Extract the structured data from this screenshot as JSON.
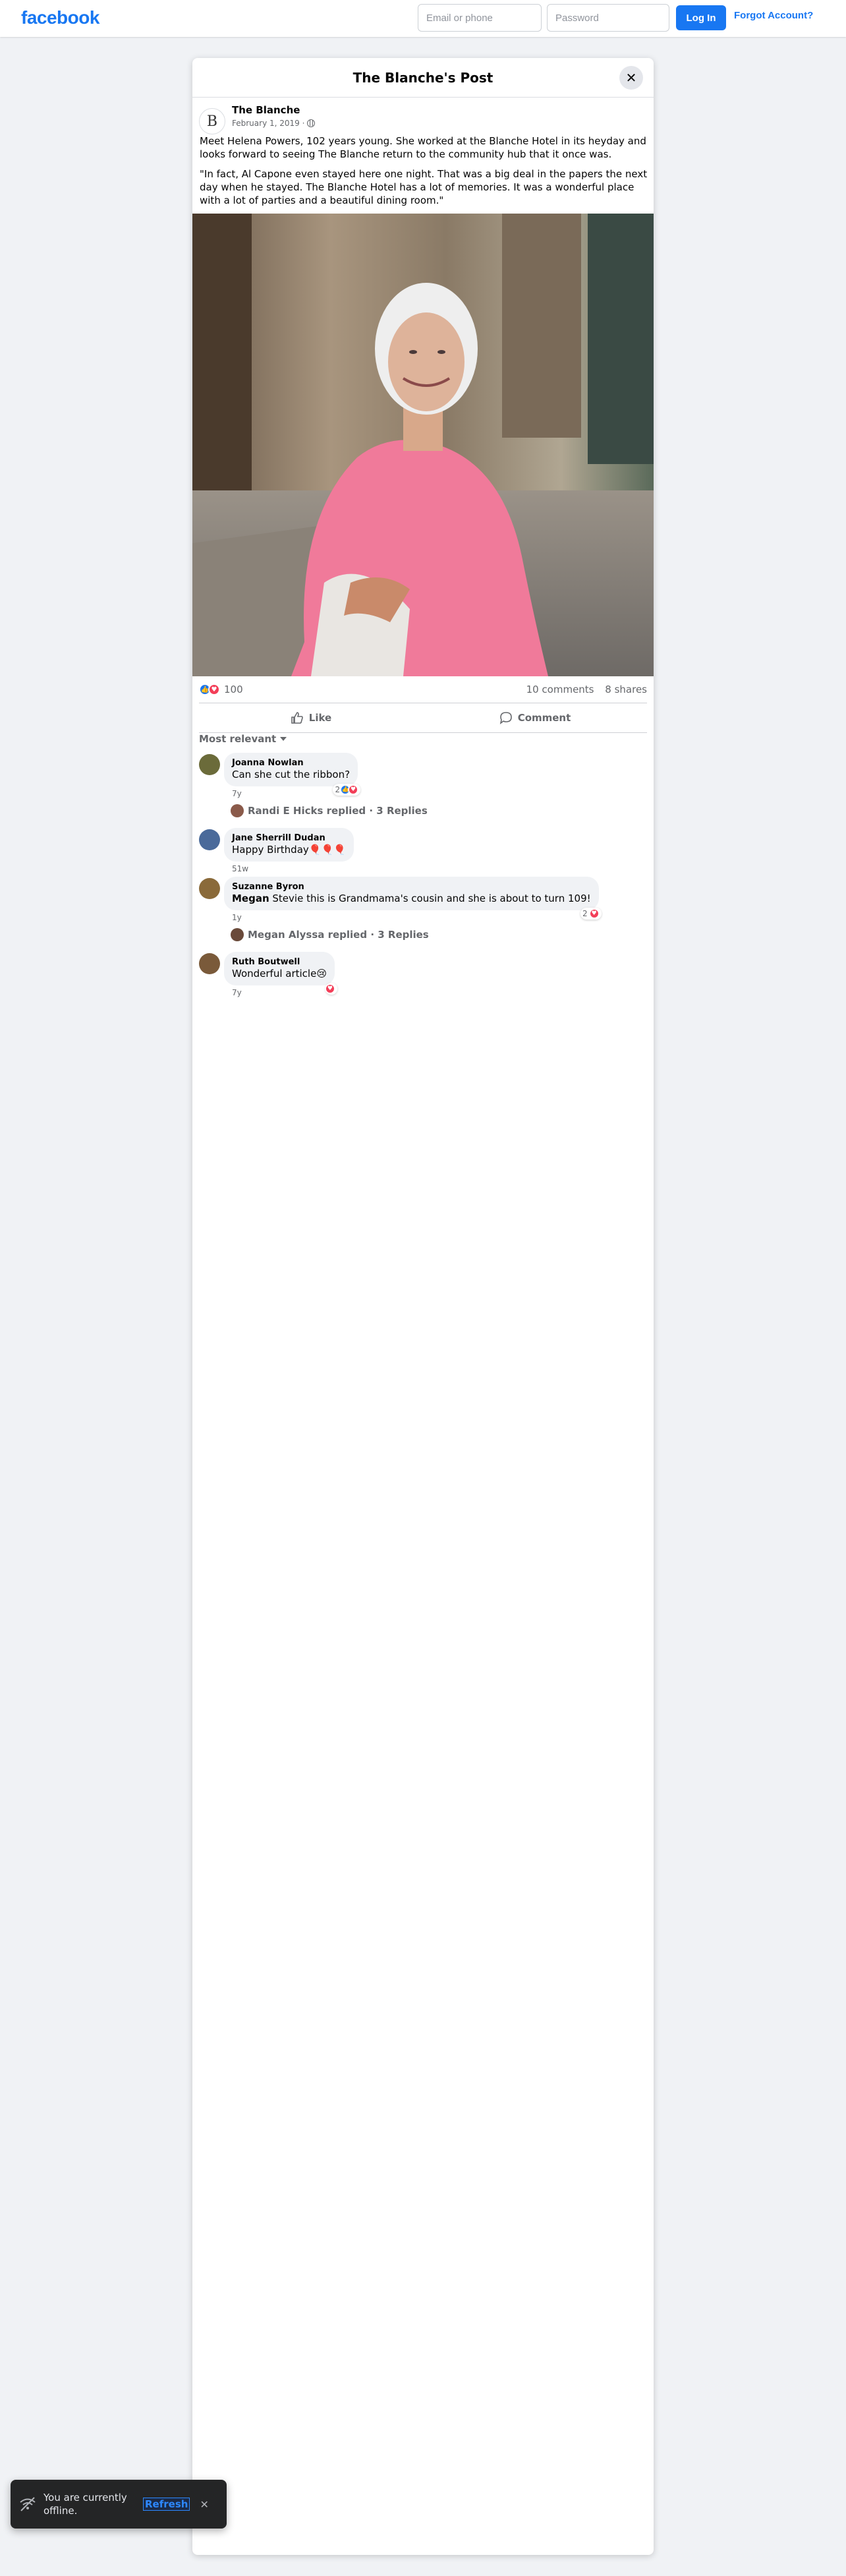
{
  "topbar": {
    "logo": "facebook",
    "email_placeholder": "Email or phone",
    "password_placeholder": "Password",
    "login_label": "Log In",
    "forgot_label": "Forgot Account?"
  },
  "modal": {
    "title": "The Blanche's Post",
    "close_icon": "close-icon"
  },
  "post": {
    "page_initial": "B",
    "page_name": "The Blanche",
    "date": "February 1, 2019 ·",
    "privacy_icon": "globe-icon",
    "paragraphs": [
      "Meet Helena Powers, 102 years young. She worked at the Blanche Hotel in its heyday and looks forward to seeing The Blanche return to the community hub that it once was.",
      "\"In fact, Al Capone even stayed here one night. That was a big deal in the papers the next day when he stayed. The Blanche Hotel has a lot of memories. It was a wonderful place with a lot of parties and a beautiful dining room.\""
    ],
    "reactions_count": "100",
    "comments_count": "10 comments",
    "shares_count": "8 shares",
    "like_label": "Like",
    "comment_label": "Comment",
    "sort_label": "Most relevant"
  },
  "comments": [
    {
      "name": "Joanna Nowlan",
      "text": "Can she cut the ribbon?",
      "time": "7y",
      "reaction_count": "2",
      "avatar_color": "#6b6b3a"
    },
    {
      "name": "Jane Sherrill Dudan",
      "text": "Happy Birthday🎈🎈🎈",
      "time": "51w",
      "avatar_color": "#4a6a9a"
    },
    {
      "name": "Suzanne Byron",
      "mention": "Megan",
      "text": " Stevie this is Grandmama's cousin and she is about to turn 109!",
      "time": "1y",
      "reaction_count": "2",
      "avatar_color": "#8a6a3a"
    },
    {
      "name": "Ruth Boutwell",
      "text": "Wonderful article😢",
      "time": "7y",
      "avatar_color": "#7a5a3a"
    }
  ],
  "replies": [
    {
      "text": "Randi E Hicks replied · 3 Replies",
      "avatar_color": "#8a5a4a"
    },
    {
      "text": "Megan Alyssa replied · 3 Replies",
      "avatar_color": "#6a4a3a"
    }
  ],
  "toast": {
    "message": "You are currently offline.",
    "refresh_label": "Refresh"
  }
}
